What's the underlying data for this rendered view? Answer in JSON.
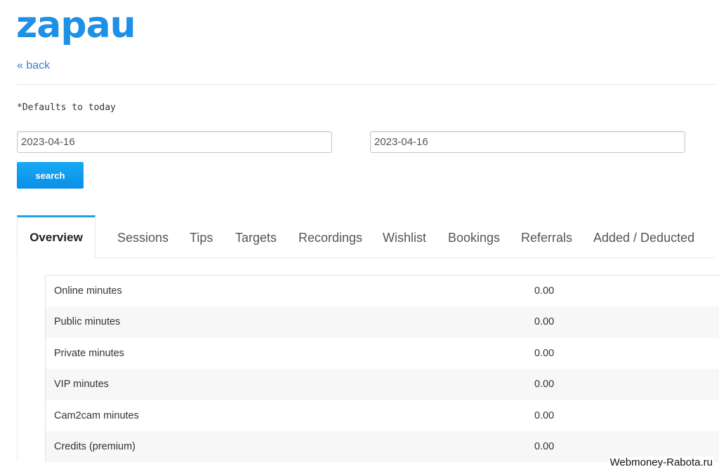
{
  "brand": {
    "logo": "zapau"
  },
  "nav": {
    "back": "« back"
  },
  "filter": {
    "note": "*Defaults to today",
    "date_from": "2023-04-16",
    "date_to": "2023-04-16",
    "search_label": "search"
  },
  "tabs": [
    {
      "label": "Overview",
      "active": true
    },
    {
      "label": "Sessions"
    },
    {
      "label": "Tips"
    },
    {
      "label": "Targets"
    },
    {
      "label": "Recordings"
    },
    {
      "label": "Wishlist"
    },
    {
      "label": "Bookings"
    },
    {
      "label": "Referrals"
    },
    {
      "label": "Added / Deducted"
    }
  ],
  "stats": [
    {
      "label": "Online minutes",
      "value": "0.00"
    },
    {
      "label": "Public minutes",
      "value": "0.00"
    },
    {
      "label": "Private minutes",
      "value": "0.00"
    },
    {
      "label": "VIP minutes",
      "value": "0.00"
    },
    {
      "label": "Cam2cam minutes",
      "value": "0.00"
    },
    {
      "label": "Credits (premium)",
      "value": "0.00"
    }
  ],
  "watermark": "Webmoney-Rabota.ru",
  "colors": {
    "brand": "#1e90e6",
    "accent": "#1aa3f0",
    "link": "#3a7fd5"
  }
}
